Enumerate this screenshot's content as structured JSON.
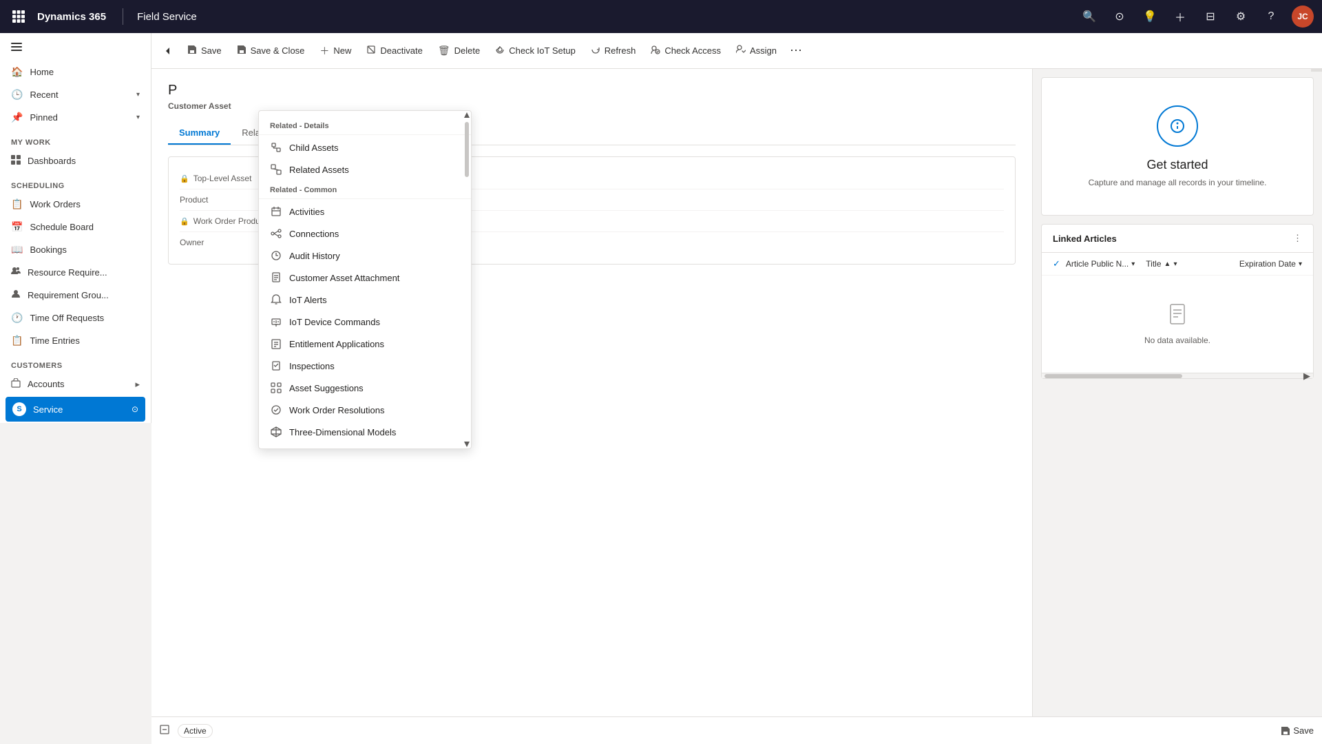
{
  "topNav": {
    "brand": "Dynamics 365",
    "module": "Field Service",
    "avatarInitials": "JC"
  },
  "toolbar": {
    "back": "←",
    "save": "Save",
    "saveClose": "Save & Close",
    "new": "New",
    "deactivate": "Deactivate",
    "delete": "Delete",
    "checkIot": "Check IoT Setup",
    "refresh": "Refresh",
    "checkAccess": "Check Access",
    "assign": "Assign",
    "more": "⋯"
  },
  "record": {
    "title": "P",
    "subtitle": "Customer Asset"
  },
  "tabs": [
    {
      "label": "Summary",
      "active": true
    },
    {
      "label": "Related",
      "active": false
    }
  ],
  "formFields": [
    {
      "label": "Top-Level Asset",
      "locked": true,
      "value": ""
    },
    {
      "label": "Product",
      "locked": false,
      "value": ""
    },
    {
      "label": "Work Order Products",
      "locked": true,
      "value": ""
    },
    {
      "label": "Owner",
      "locked": false,
      "value": ""
    }
  ],
  "timeline": {
    "title": "Get started",
    "description": "Capture and manage all records in your timeline."
  },
  "linkedArticles": {
    "title": "Linked Articles",
    "columns": [
      {
        "label": "Article Public N...",
        "sort": "↓"
      },
      {
        "label": "Title",
        "sort": "↑"
      },
      {
        "label": "Expiration Date",
        "sort": "↓"
      }
    ],
    "emptyText": "No data available."
  },
  "statusBar": {
    "status": "Active",
    "saveLabel": "Save"
  },
  "sidebar": {
    "sections": [
      {
        "items": [
          {
            "icon": "🏠",
            "label": "Home"
          },
          {
            "icon": "🕒",
            "label": "Recent",
            "chevron": "▾"
          },
          {
            "icon": "📌",
            "label": "Pinned",
            "chevron": "▾"
          }
        ]
      },
      {
        "label": "My Work",
        "items": [
          {
            "icon": "📋",
            "label": "Dashboards"
          }
        ]
      },
      {
        "label": "Scheduling",
        "items": [
          {
            "icon": "📝",
            "label": "Work Orders"
          },
          {
            "icon": "📅",
            "label": "Schedule Board"
          },
          {
            "icon": "📖",
            "label": "Bookings"
          },
          {
            "icon": "👥",
            "label": "Resource Require..."
          },
          {
            "icon": "👥",
            "label": "Requirement Grou..."
          },
          {
            "icon": "🕐",
            "label": "Time Off Requests"
          },
          {
            "icon": "📋",
            "label": "Time Entries"
          }
        ]
      },
      {
        "label": "Customers",
        "items": [
          {
            "icon": "🏢",
            "label": "Accounts",
            "expandable": true
          },
          {
            "icon": "🔵",
            "label": "Service",
            "active": true,
            "settings": true
          }
        ]
      }
    ]
  },
  "dropdown": {
    "sections": [
      {
        "label": "Related - Details",
        "items": [
          {
            "icon": "asset",
            "label": "Child Assets"
          },
          {
            "icon": "asset",
            "label": "Related Assets"
          }
        ]
      },
      {
        "label": "Related - Common",
        "items": [
          {
            "icon": "activity",
            "label": "Activities"
          },
          {
            "icon": "connection",
            "label": "Connections"
          },
          {
            "icon": "audit",
            "label": "Audit History"
          },
          {
            "icon": "attachment",
            "label": "Customer Asset Attachment"
          },
          {
            "icon": "iot",
            "label": "IoT Alerts"
          },
          {
            "icon": "device",
            "label": "IoT Device Commands"
          },
          {
            "icon": "entitlement",
            "label": "Entitlement Applications"
          },
          {
            "icon": "inspect",
            "label": "Inspections"
          },
          {
            "icon": "suggest",
            "label": "Asset Suggestions"
          },
          {
            "icon": "resolution",
            "label": "Work Order Resolutions"
          },
          {
            "icon": "3d",
            "label": "Three-Dimensional Models"
          }
        ]
      }
    ]
  }
}
